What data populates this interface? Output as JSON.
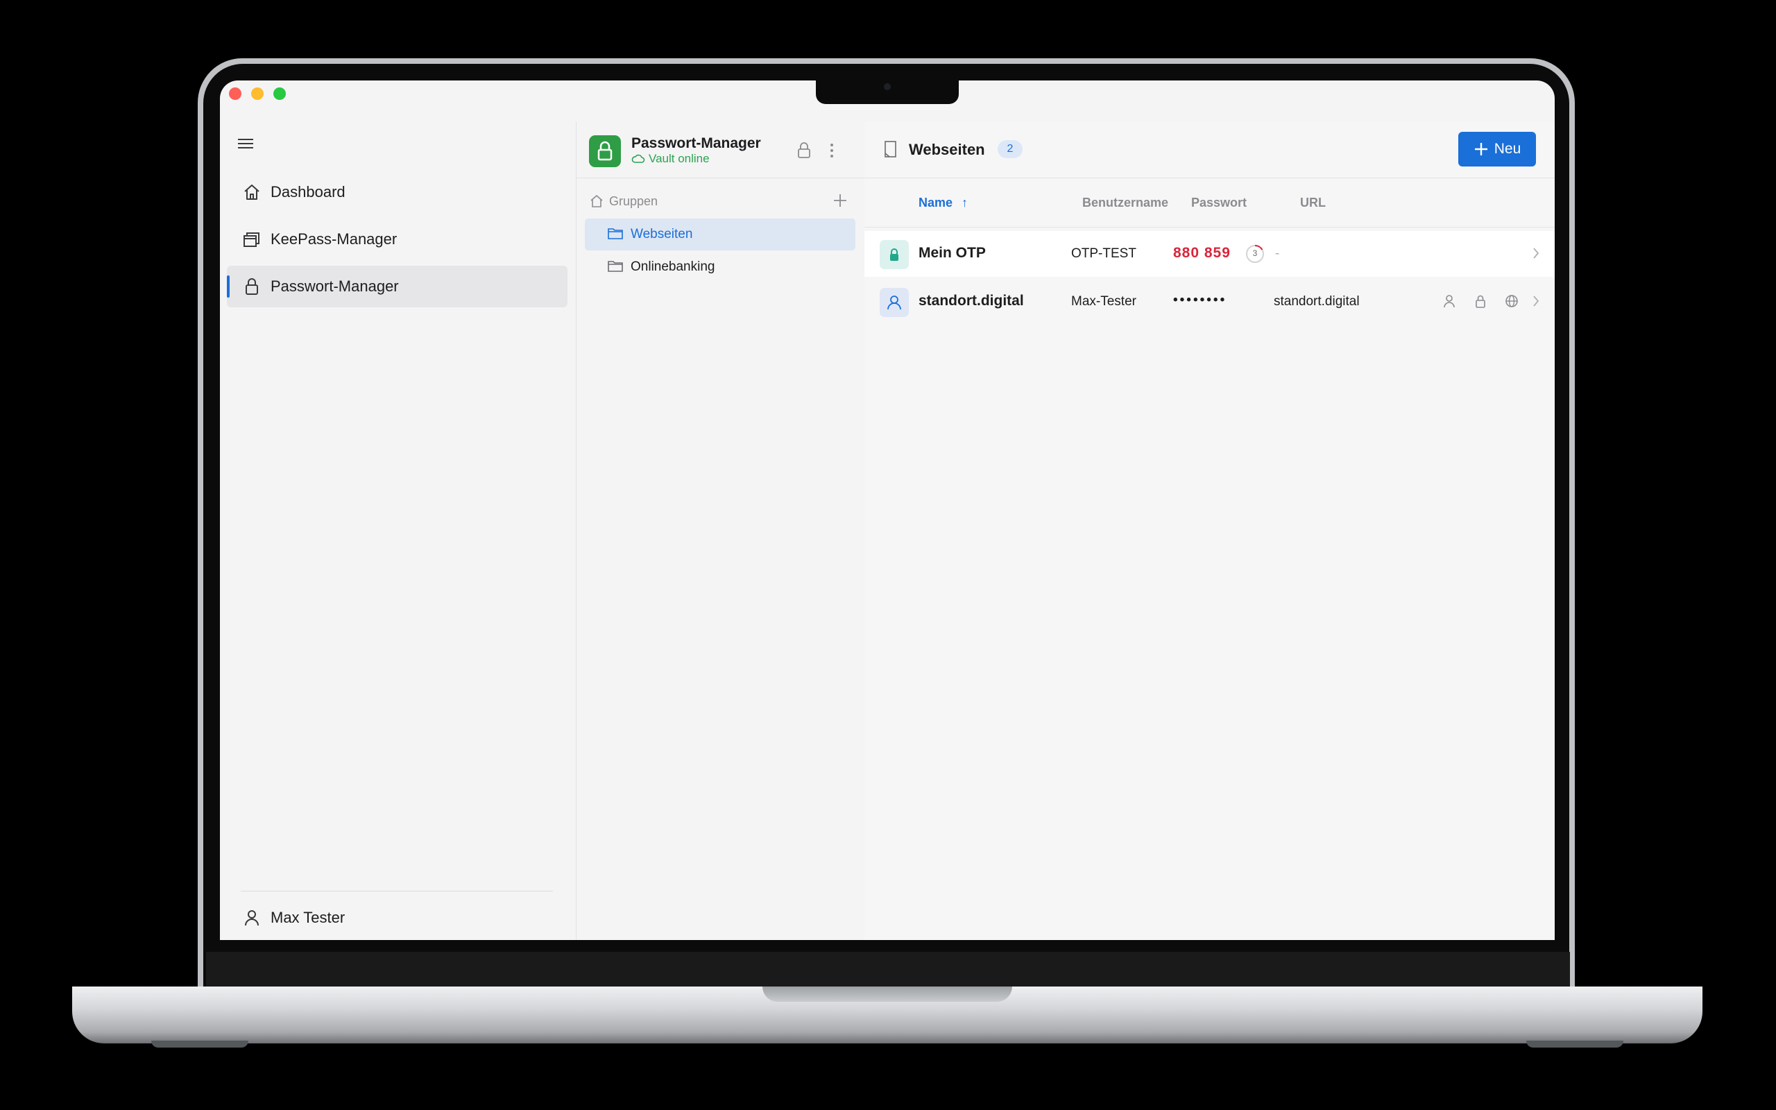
{
  "sidebar": {
    "items": [
      {
        "label": "Dashboard",
        "icon": "home-icon"
      },
      {
        "label": "KeePass-Manager",
        "icon": "windows-icon"
      },
      {
        "label": "Passwort-Manager",
        "icon": "lock-icon",
        "active": true
      }
    ],
    "user": {
      "name": "Max Tester",
      "icon": "user-icon"
    }
  },
  "vault": {
    "title": "Passwort-Manager",
    "status": "Vault online",
    "status_color": "#2aa44f",
    "accent": "#2e9d46"
  },
  "groups": {
    "header": "Gruppen",
    "items": [
      {
        "label": "Webseiten",
        "selected": true
      },
      {
        "label": "Onlinebanking",
        "selected": false
      }
    ]
  },
  "list": {
    "title": "Webseiten",
    "count": "2",
    "new_button": "Neu",
    "columns": {
      "name": "Name",
      "sort_indicator": "↑",
      "username": "Benutzername",
      "password": "Passwort",
      "url": "URL"
    },
    "rows": [
      {
        "name": "Mein OTP",
        "username": "OTP-TEST",
        "password": "880 859",
        "timer": "3",
        "url": "-",
        "type": "otp"
      },
      {
        "name": "standort.digital",
        "username": "Max-Tester",
        "password": "••••••••",
        "url": "standort.digital",
        "type": "login"
      }
    ]
  },
  "colors": {
    "accent_blue": "#1a6fd8",
    "otp_red": "#d9263b",
    "window_bg": "#f4f4f5"
  }
}
